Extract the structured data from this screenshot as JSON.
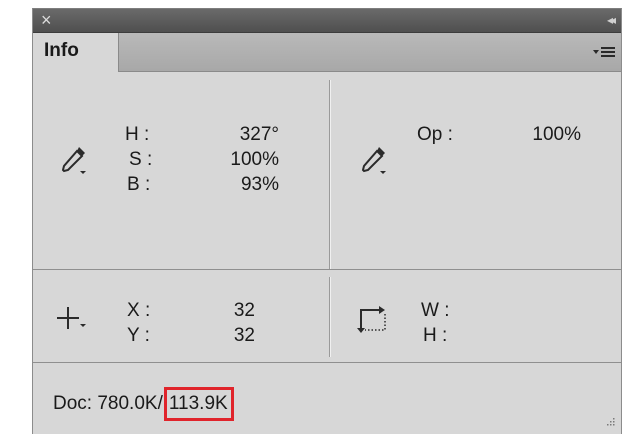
{
  "panel": {
    "title_bar": {
      "close_glyph": "×",
      "collapse_glyph": "◂◂"
    },
    "tab": {
      "label": "Info"
    },
    "flyout_icon": "panel-menu-icon"
  },
  "color_readout": {
    "icon": "eyedropper-icon",
    "rows": [
      {
        "label": "H :",
        "value": "327°"
      },
      {
        "label": "S :",
        "value": "100%"
      },
      {
        "label": "B :",
        "value": "93%"
      }
    ]
  },
  "opacity_readout": {
    "icon": "eyedropper-icon",
    "label": "Op :",
    "value": "100%"
  },
  "position_readout": {
    "icon": "crosshair-icon",
    "rows": [
      {
        "label": "X :",
        "value": "32"
      },
      {
        "label": "Y :",
        "value": "32"
      }
    ]
  },
  "size_readout": {
    "icon": "selection-size-icon",
    "rows": [
      {
        "label": "W :",
        "value": ""
      },
      {
        "label": "H :",
        "value": ""
      }
    ]
  },
  "doc_status": {
    "prefix": "Doc: ",
    "first_value": "780.0K",
    "separator": "/",
    "second_value": "113.9K",
    "highlight_color": "#e0242b"
  }
}
